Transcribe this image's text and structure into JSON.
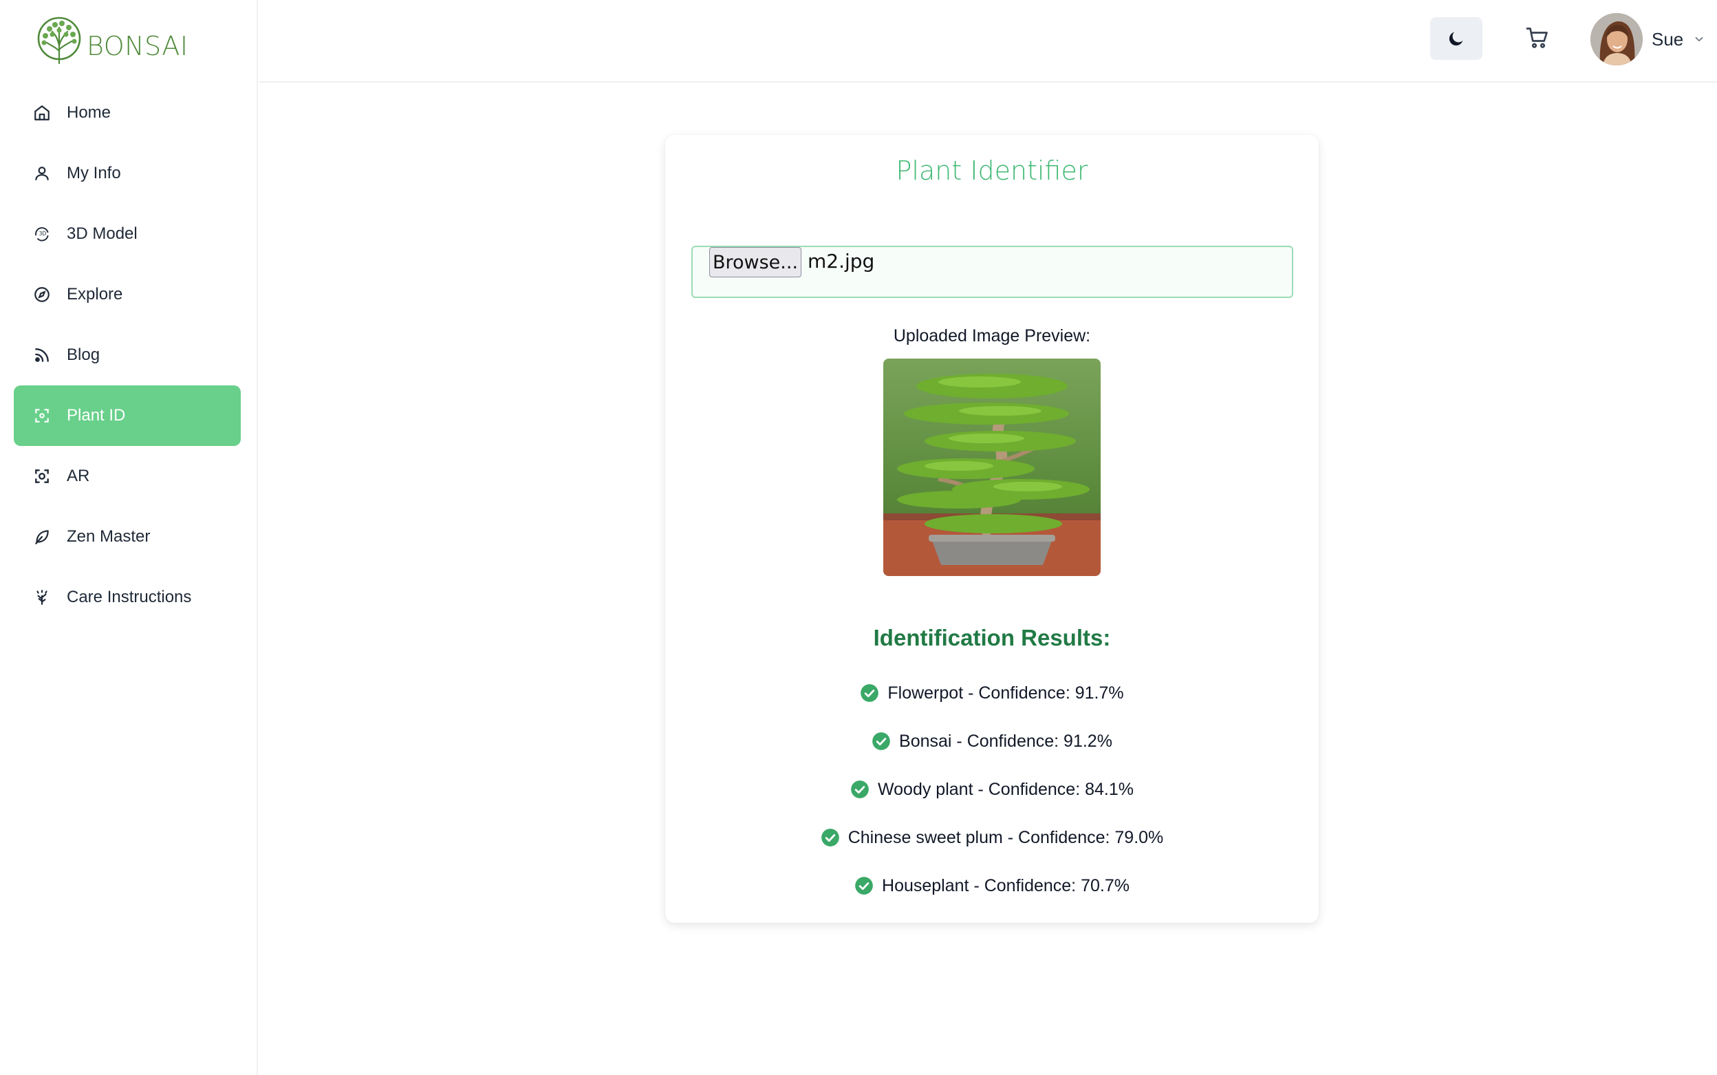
{
  "brand": {
    "name": "BONSAI",
    "color": "#4f8a3a"
  },
  "sidebar": {
    "items": [
      {
        "label": "Home",
        "icon": "home-icon",
        "active": false
      },
      {
        "label": "My Info",
        "icon": "user-icon",
        "active": false
      },
      {
        "label": "3D Model",
        "icon": "rotate-3d-icon",
        "active": false
      },
      {
        "label": "Explore",
        "icon": "compass-icon",
        "active": false
      },
      {
        "label": "Blog",
        "icon": "rss-icon",
        "active": false
      },
      {
        "label": "Plant ID",
        "icon": "scan-icon",
        "active": true
      },
      {
        "label": "AR",
        "icon": "ar-scan-icon",
        "active": false
      },
      {
        "label": "Zen Master",
        "icon": "leaf-icon",
        "active": false
      },
      {
        "label": "Care Instructions",
        "icon": "sprout-icon",
        "active": false
      }
    ],
    "active_color": "#68d08a"
  },
  "header": {
    "theme_icon": "moon-icon",
    "cart_icon": "cart-icon",
    "user": {
      "name": "Sue",
      "chevron_icon": "chevron-down-icon"
    }
  },
  "identifier": {
    "title": "Plant Identifier",
    "file_input": {
      "button_label": "Browse...",
      "file_name": "m2.jpg"
    },
    "preview_label": "Uploaded Image Preview:",
    "results_title": "Identification Results:",
    "results": [
      {
        "text": "Flowerpot - Confidence: 91.7%"
      },
      {
        "text": "Bonsai - Confidence: 91.2%"
      },
      {
        "text": "Woody plant - Confidence: 84.1%"
      },
      {
        "text": "Chinese sweet plum - Confidence: 79.0%"
      },
      {
        "text": "Houseplant - Confidence: 70.7%"
      }
    ],
    "accent": "#3eb873",
    "results_title_color": "#217a45"
  }
}
